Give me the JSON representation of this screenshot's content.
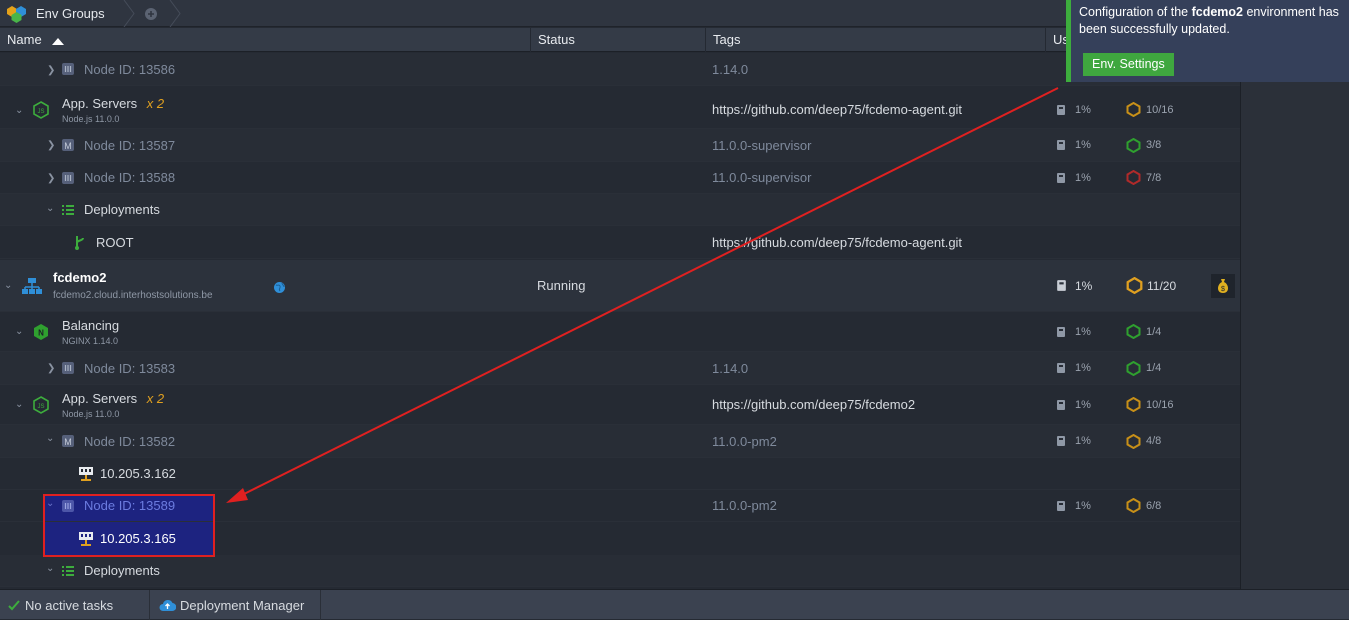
{
  "topbar": {
    "tab_label": "Env Groups"
  },
  "columns": {
    "name": "Name",
    "status": "Status",
    "tags": "Tags",
    "usage": "Us"
  },
  "rows": {
    "r0": {
      "name": "Node ID: 13586",
      "tag": "1.14.0"
    },
    "r1": {
      "name": "App. Servers",
      "mult": "x 2",
      "sub": "Node.js 11.0.0",
      "tag": "https://github.com/deep75/fcdemo-agent.git",
      "disk": "1%",
      "cloudlets": "10/16"
    },
    "r2": {
      "name": "Node ID: 13587",
      "tag": "11.0.0-supervisor",
      "disk": "1%",
      "cloudlets": "3/8"
    },
    "r3": {
      "name": "Node ID: 13588",
      "tag": "11.0.0-supervisor",
      "disk": "1%",
      "cloudlets": "7/8"
    },
    "r4": {
      "name": "Deployments"
    },
    "r5": {
      "name": "ROOT",
      "tag": "https://github.com/deep75/fcdemo-agent.git"
    },
    "env": {
      "name": "fcdemo2",
      "domain": "fcdemo2.cloud.interhostsolutions.be",
      "status": "Running",
      "disk": "1%",
      "cloudlets": "11/20"
    },
    "r7": {
      "name": "Balancing",
      "sub": "NGINX 1.14.0",
      "disk": "1%",
      "cloudlets": "1/4"
    },
    "r8": {
      "name": "Node ID: 13583",
      "tag": "1.14.0",
      "disk": "1%",
      "cloudlets": "1/4"
    },
    "r9": {
      "name": "App. Servers",
      "mult": "x 2",
      "sub": "Node.js 11.0.0",
      "tag": "https://github.com/deep75/fcdemo2",
      "disk": "1%",
      "cloudlets": "10/16"
    },
    "r10": {
      "name": "Node ID: 13582",
      "tag": "11.0.0-pm2",
      "disk": "1%",
      "cloudlets": "4/8"
    },
    "r11": {
      "name": "10.205.3.162"
    },
    "r12": {
      "name": "Node ID: 13589",
      "tag": "11.0.0-pm2",
      "disk": "1%",
      "cloudlets": "6/8"
    },
    "r13": {
      "name": "10.205.3.165"
    },
    "r14": {
      "name": "Deployments"
    }
  },
  "toast": {
    "text_before": "Configuration of the",
    "env_name": "fcdemo2",
    "text_after": "environment has been successfully updated.",
    "button_label": "Env. Settings"
  },
  "footer": {
    "tasks_label": "No active tasks",
    "deploy_label": "Deployment Manager"
  },
  "colors": {
    "green": "#3dad3d",
    "orange": "#e0a020",
    "red": "#e02020",
    "highlight": "#1d2380"
  }
}
